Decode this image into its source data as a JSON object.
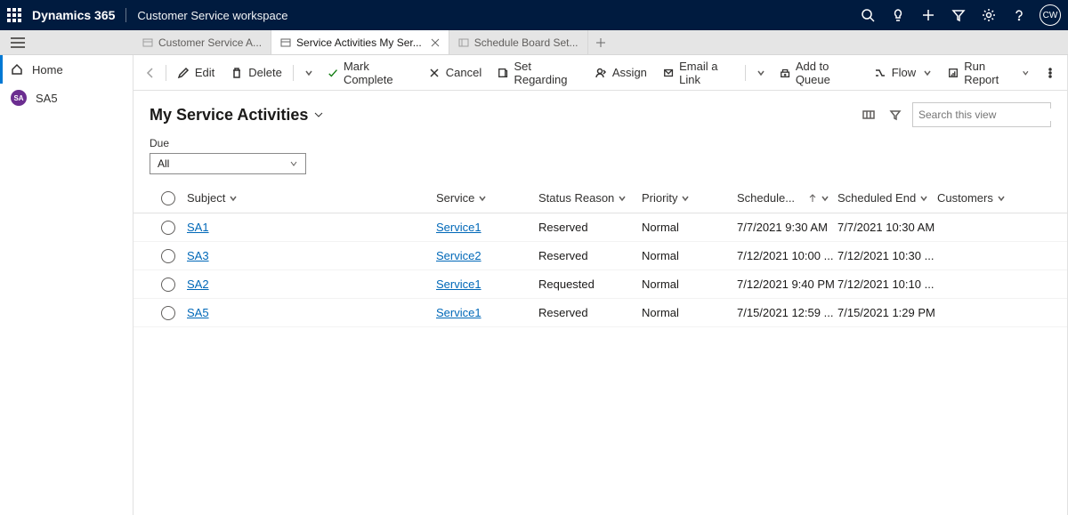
{
  "topbar": {
    "brand": "Dynamics 365",
    "workspace": "Customer Service workspace",
    "avatar": "CW"
  },
  "tabs": {
    "t0": "Customer Service A...",
    "t1": "Service Activities My Ser...",
    "t2": "Schedule Board Set..."
  },
  "sidebar": {
    "home": "Home",
    "sa_badge": "SA",
    "sa_label": "SA5"
  },
  "cmd": {
    "edit": "Edit",
    "delete": "Delete",
    "mark": "Mark Complete",
    "cancel": "Cancel",
    "regarding": "Set Regarding",
    "assign": "Assign",
    "email": "Email a Link",
    "queue": "Add to Queue",
    "flow": "Flow",
    "report": "Run Report"
  },
  "view": {
    "title": "My Service Activities",
    "search_placeholder": "Search this view"
  },
  "due": {
    "label": "Due",
    "value": "All"
  },
  "cols": {
    "subject": "Subject",
    "service": "Service",
    "status": "Status Reason",
    "priority": "Priority",
    "start": "Schedule...",
    "end": "Scheduled End",
    "cust": "Customers"
  },
  "rows": [
    {
      "subject": "SA1",
      "service": "Service1",
      "status": "Reserved",
      "priority": "Normal",
      "start": "7/7/2021 9:30 AM",
      "end": "7/7/2021 10:30 AM",
      "cust": ""
    },
    {
      "subject": "SA3",
      "service": "Service2",
      "status": "Reserved",
      "priority": "Normal",
      "start": "7/12/2021 10:00 ...",
      "end": "7/12/2021 10:30 ...",
      "cust": ""
    },
    {
      "subject": "SA2",
      "service": "Service1",
      "status": "Requested",
      "priority": "Normal",
      "start": "7/12/2021 9:40 PM",
      "end": "7/12/2021 10:10 ...",
      "cust": ""
    },
    {
      "subject": "SA5",
      "service": "Service1",
      "status": "Reserved",
      "priority": "Normal",
      "start": "7/15/2021 12:59 ...",
      "end": "7/15/2021 1:29 PM",
      "cust": ""
    }
  ]
}
